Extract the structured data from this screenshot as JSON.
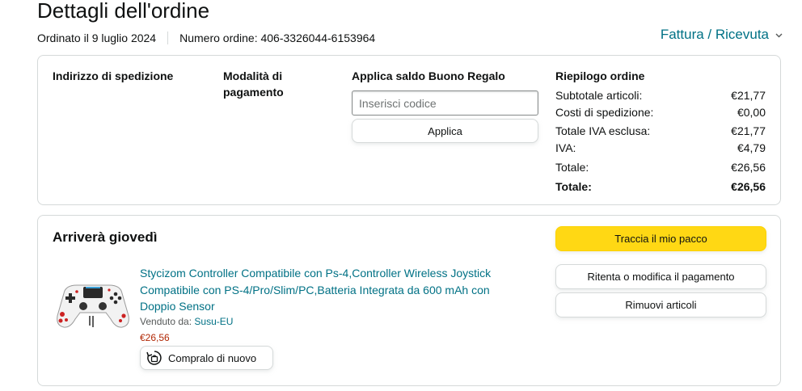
{
  "header": {
    "title": "Dettagli dell'ordine",
    "ordered_on": "Ordinato il 9 luglio 2024",
    "order_number": "Numero ordine: 406-3326044-6153964",
    "invoice_link": "Fattura / Ricevuta"
  },
  "details": {
    "shipping_title": "Indirizzo di spedizione",
    "payment_title": "Modalità di pagamento",
    "gift_title": "Applica saldo Buono Regalo",
    "gift_placeholder": "Inserisci codice",
    "apply_label": "Applica",
    "summary_title": "Riepilogo ordine",
    "summary": [
      {
        "label": "Subtotale articoli:",
        "value": "€21,77"
      },
      {
        "label": "Costi di spedizione:",
        "value": "€0,00"
      },
      {
        "label": "Totale IVA esclusa:",
        "value": "€21,77"
      },
      {
        "label": "IVA:",
        "value": "€4,79"
      },
      {
        "label": "Totale:",
        "value": "€26,56"
      },
      {
        "label": "Totale:",
        "value": "€26,56"
      }
    ]
  },
  "shipment": {
    "arrival": "Arriverà giovedì",
    "product_title": "Stycizom Controller Compatibile con Ps-4,Controller Wireless Joystick Compatibile con PS-4/Pro/Slim/PC,Batteria Integrata da 600 mAh con Doppio Sensor",
    "seller_prefix": "Venduto da: ",
    "seller_name": "Susu-EU",
    "price": "€26,56",
    "buy_again_label": "Compralo di nuovo",
    "track_label": "Traccia il mio pacco",
    "retry_label": "Ritenta o modifica il pagamento",
    "remove_label": "Rimuovi articoli"
  },
  "colors": {
    "link": "#007185",
    "price": "#b12704",
    "primary_button": "#ffd814",
    "border": "#d5d9d9"
  },
  "icons": {
    "invoice_chevron": "chevron-down-icon",
    "buy_again": "buy-again-icon"
  }
}
